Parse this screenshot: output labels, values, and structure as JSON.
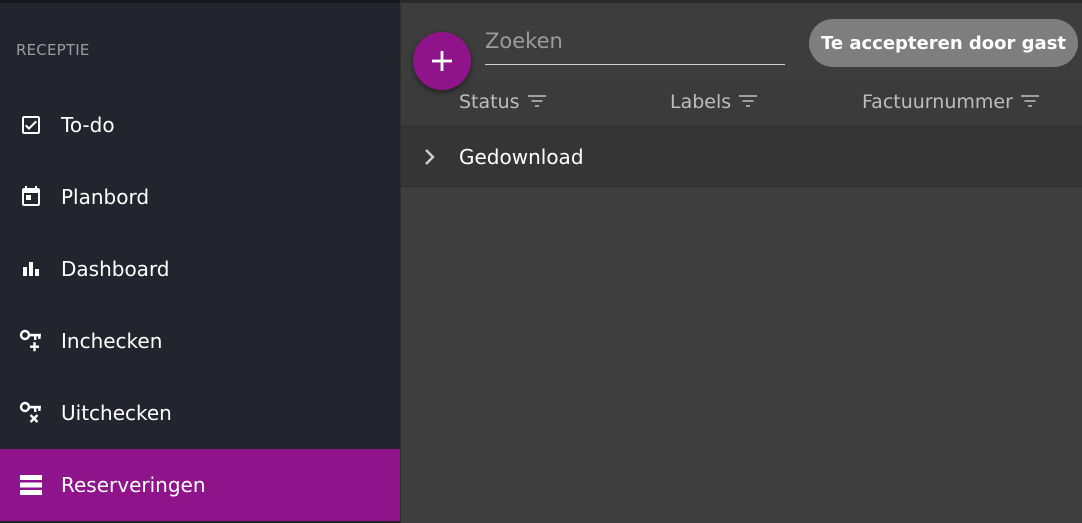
{
  "sidebar": {
    "section_title": "RECEPTIE",
    "items": [
      {
        "label": "To-do",
        "icon": "checkbox-icon"
      },
      {
        "label": "Planbord",
        "icon": "calendar-icon"
      },
      {
        "label": "Dashboard",
        "icon": "bar-chart-icon"
      },
      {
        "label": "Inchecken",
        "icon": "key-plus-icon"
      },
      {
        "label": "Uitchecken",
        "icon": "key-x-icon"
      },
      {
        "label": "Reserveringen",
        "icon": "list-icon",
        "active": true
      }
    ]
  },
  "toolbar": {
    "add_icon": "plus-icon",
    "search_placeholder": "Zoeken",
    "filter_chip": "Te accepteren door gast"
  },
  "table": {
    "columns": [
      "Status",
      "Labels",
      "Factuurnummer"
    ],
    "filter_icon": "filter-icon",
    "groups": [
      {
        "label": "Gedownload",
        "icon": "chevron-right-icon"
      }
    ]
  },
  "colors": {
    "accent": "#8f148b",
    "sidebar_bg": "#22252e",
    "main_bg": "#3f3f3f",
    "chip_bg": "#7e7e7e"
  }
}
